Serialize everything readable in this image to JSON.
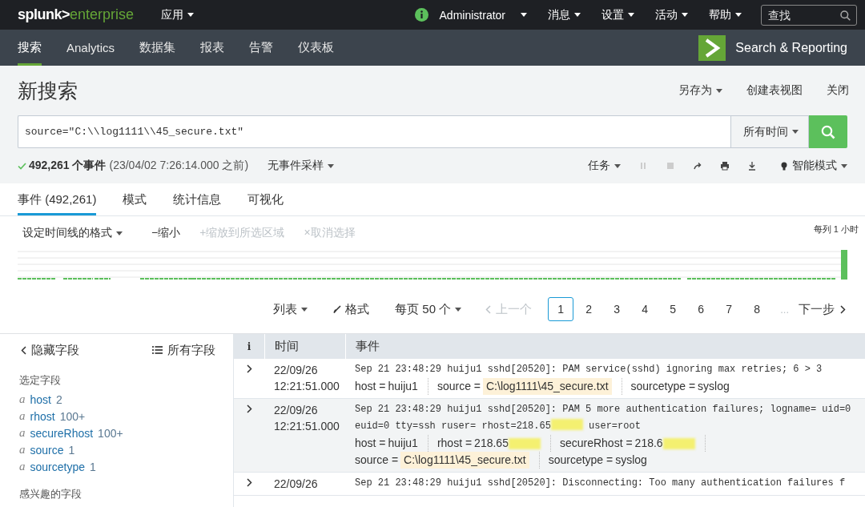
{
  "topbar": {
    "logo_main": "splunk>",
    "logo_product": "enterprise",
    "apps_menu": "应用",
    "user_menu": "Administrator",
    "menus": [
      "消息",
      "设置",
      "活动",
      "帮助"
    ],
    "search": {
      "placeholder": "查找"
    }
  },
  "nav": {
    "tabs": [
      {
        "label": "搜索",
        "selected": true
      },
      {
        "label": "Analytics",
        "selected": false
      },
      {
        "label": "数据集",
        "selected": false
      },
      {
        "label": "报表",
        "selected": false
      },
      {
        "label": "告警",
        "selected": false
      },
      {
        "label": "仪表板",
        "selected": false
      }
    ],
    "app_title": "Search & Reporting"
  },
  "header": {
    "title": "新搜索",
    "actions": [
      {
        "label": "另存为",
        "kind": "menu"
      },
      {
        "label": "创建表视图",
        "kind": "link"
      },
      {
        "label": "关闭",
        "kind": "link"
      }
    ]
  },
  "search_bar": {
    "query": "source=\"C:\\\\log1111\\\\45_secure.txt\"",
    "time_range": "所有时间"
  },
  "status": {
    "count": "492,261 个事件",
    "when": "(23/04/02 7:26:14.000 之前)",
    "sampling": "无事件采样",
    "job": "任务",
    "mode": "智能模式"
  },
  "result_tabs": [
    {
      "label": "事件 (492,261)",
      "selected": true
    },
    {
      "label": "模式",
      "selected": false
    },
    {
      "label": "统计信息",
      "selected": false
    },
    {
      "label": "可视化",
      "selected": false
    }
  ],
  "timeline": {
    "format_menu": "设定时间线的格式",
    "tools": [
      {
        "symbol": "−",
        "label": "缩小",
        "disabled": false
      },
      {
        "symbol": "+",
        "label": "缩放到所选区域",
        "disabled": true
      },
      {
        "symbol": "×",
        "label": "取消选择",
        "disabled": true
      }
    ],
    "scale": "每列 1 小时"
  },
  "pager": {
    "view_menu": "列表",
    "format": "格式",
    "per_page": "每页 50 个",
    "prev": {
      "label": "上一个",
      "disabled": true
    },
    "pages": [
      {
        "label": "1",
        "selected": true
      },
      {
        "label": "2",
        "selected": false
      },
      {
        "label": "3",
        "selected": false
      },
      {
        "label": "4",
        "selected": false
      },
      {
        "label": "5",
        "selected": false
      },
      {
        "label": "6",
        "selected": false
      },
      {
        "label": "7",
        "selected": false
      },
      {
        "label": "8",
        "selected": false
      }
    ],
    "ellipsis": "...",
    "next": {
      "label": "下一步",
      "disabled": false
    }
  },
  "sidebar": {
    "hide": "隐藏字段",
    "all": "所有字段",
    "selected_heading": "选定字段",
    "selected_fields": [
      {
        "type": "a",
        "name": "host",
        "count": "2"
      },
      {
        "type": "a",
        "name": "rhost",
        "count": "100+"
      },
      {
        "type": "a",
        "name": "secureRhost",
        "count": "100+"
      },
      {
        "type": "a",
        "name": "source",
        "count": "1"
      },
      {
        "type": "a",
        "name": "sourcetype",
        "count": "1"
      }
    ],
    "interesting_heading": "感兴趣的字段"
  },
  "events": {
    "columns": [
      "i",
      "时间",
      "事件"
    ],
    "rows": [
      {
        "date": "22/09/26",
        "time": "12:21:51.000",
        "raw": [
          {
            "kind": "text",
            "text": "Sep 21 23:48:29 huiju1 sshd[20520]: PAM service(sshd) ignoring max retries; 6 > 3"
          }
        ],
        "fields": [
          {
            "name": "host =",
            "value": "huiju1",
            "highlight": false,
            "redacted": false
          },
          {
            "name": "source =",
            "value": "C:\\log1111\\45_secure.txt",
            "highlight": true,
            "redacted": false
          },
          {
            "name": "sourcetype =",
            "value": "syslog",
            "highlight": false,
            "redacted": false
          }
        ]
      },
      {
        "date": "22/09/26",
        "time": "12:21:51.000",
        "raw": [
          {
            "kind": "text",
            "text": "Sep 21 23:48:29 huiju1 sshd[20520]: PAM 5 more authentication failures; logname= uid=0 euid=0 tty=ssh ruser= rhost=218.65"
          },
          {
            "kind": "redacted"
          },
          {
            "kind": "text",
            "text": " user=root"
          }
        ],
        "fields": [
          {
            "name": "host =",
            "value": "huiju1",
            "highlight": false,
            "redacted": false
          },
          {
            "name": "rhost =",
            "value": "218.65",
            "highlight": false,
            "redacted": true
          },
          {
            "name": "secureRhost =",
            "value": "218.6",
            "highlight": false,
            "redacted": true
          },
          {
            "name": "source =",
            "value": "C:\\log1111\\45_secure.txt",
            "highlight": true,
            "redacted": false
          },
          {
            "name": "sourcetype =",
            "value": "syslog",
            "highlight": false,
            "redacted": false
          }
        ]
      },
      {
        "date": "22/09/26",
        "time": "",
        "raw": [
          {
            "kind": "text",
            "text": "Sep 21 23:48:29 huiju1 sshd[20520]: Disconnecting: Too many authentication failures f"
          }
        ],
        "fields": []
      }
    ]
  }
}
